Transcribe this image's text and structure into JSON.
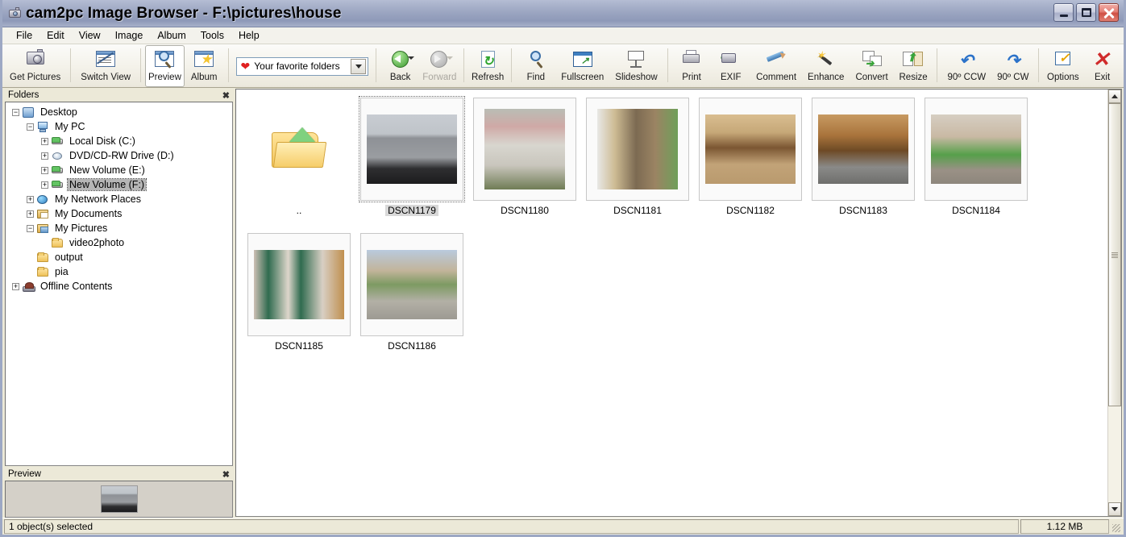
{
  "window": {
    "title": "cam2pc Image Browser - F:\\pictures\\house",
    "icon": "camera-icon",
    "controls": {
      "minimize": "minimize-icon",
      "maximize": "maximize-icon",
      "close": "close-icon"
    }
  },
  "menubar": {
    "items": [
      "File",
      "Edit",
      "View",
      "Image",
      "Album",
      "Tools",
      "Help"
    ]
  },
  "toolbar": {
    "buttons": [
      {
        "label": "Get Pictures",
        "icon": "camera-icon",
        "state": "normal"
      },
      {
        "label": "Switch View",
        "icon": "switch-view-icon",
        "state": "normal"
      },
      {
        "label": "Preview",
        "icon": "preview-magnifier-icon",
        "state": "active"
      },
      {
        "label": "Album",
        "icon": "album-star-icon",
        "state": "normal"
      },
      {
        "label": "Back",
        "icon": "back-arrow-icon",
        "state": "normal"
      },
      {
        "label": "Forward",
        "icon": "forward-arrow-icon",
        "state": "disabled"
      },
      {
        "label": "Refresh",
        "icon": "refresh-icon",
        "state": "normal"
      },
      {
        "label": "Find",
        "icon": "find-magnifier-icon",
        "state": "normal"
      },
      {
        "label": "Fullscreen",
        "icon": "fullscreen-icon",
        "state": "normal"
      },
      {
        "label": "Slideshow",
        "icon": "slideshow-projector-icon",
        "state": "normal"
      },
      {
        "label": "Print",
        "icon": "printer-icon",
        "state": "normal"
      },
      {
        "label": "EXIF",
        "icon": "exif-camera-icon",
        "state": "normal"
      },
      {
        "label": "Comment",
        "icon": "pencil-icon",
        "state": "normal"
      },
      {
        "label": "Enhance",
        "icon": "magic-wand-icon",
        "state": "normal"
      },
      {
        "label": "Convert",
        "icon": "convert-images-icon",
        "state": "normal"
      },
      {
        "label": "Resize",
        "icon": "resize-icon",
        "state": "normal"
      },
      {
        "label": "90º CCW",
        "icon": "rotate-ccw-icon",
        "state": "normal"
      },
      {
        "label": "90º CW",
        "icon": "rotate-cw-icon",
        "state": "normal"
      },
      {
        "label": "Options",
        "icon": "options-checkbox-icon",
        "state": "normal"
      },
      {
        "label": "Exit",
        "icon": "exit-x-icon",
        "state": "normal"
      }
    ],
    "favorites_combo": {
      "value": "Your favorite folders",
      "icon": "heart-icon",
      "dropdown_icon": "chevron-down-icon"
    }
  },
  "folders_panel": {
    "caption": "Folders",
    "close_icon": "close-icon",
    "tree": [
      {
        "label": "Desktop",
        "indent": 0,
        "expander": "minus",
        "icon": "desktop-icon",
        "selected": false
      },
      {
        "label": "My PC",
        "indent": 1,
        "expander": "minus",
        "icon": "my-pc-icon",
        "selected": false
      },
      {
        "label": "Local Disk (C:)",
        "indent": 2,
        "expander": "plus",
        "icon": "hard-drive-icon",
        "selected": false
      },
      {
        "label": "DVD/CD-RW Drive (D:)",
        "indent": 2,
        "expander": "plus",
        "icon": "dvd-drive-icon",
        "selected": false
      },
      {
        "label": "New Volume (E:)",
        "indent": 2,
        "expander": "plus",
        "icon": "hard-drive-icon",
        "selected": false
      },
      {
        "label": "New Volume (F:)",
        "indent": 2,
        "expander": "plus",
        "icon": "hard-drive-icon",
        "selected": true
      },
      {
        "label": "My Network Places",
        "indent": 1,
        "expander": "plus",
        "icon": "network-globe-icon",
        "selected": false
      },
      {
        "label": "My Documents",
        "indent": 1,
        "expander": "plus",
        "icon": "documents-icon",
        "selected": false
      },
      {
        "label": "My Pictures",
        "indent": 1,
        "expander": "minus",
        "icon": "pictures-icon",
        "selected": false
      },
      {
        "label": "video2photo",
        "indent": 2,
        "expander": "none",
        "icon": "folder-icon",
        "selected": false
      },
      {
        "label": "output",
        "indent": 1,
        "expander": "none",
        "icon": "folder-icon",
        "selected": false
      },
      {
        "label": "pia",
        "indent": 1,
        "expander": "none",
        "icon": "folder-icon",
        "selected": false
      },
      {
        "label": "Offline Contents",
        "indent": 0,
        "expander": "plus",
        "icon": "offline-contents-icon",
        "selected": false
      }
    ]
  },
  "preview_panel": {
    "caption": "Preview",
    "close_icon": "close-icon",
    "thumbnail_of": "DSCN1179"
  },
  "thumbnails": {
    "items": [
      {
        "caption": "..",
        "type": "parent-folder",
        "selected": false,
        "orientation": "none"
      },
      {
        "caption": "DSCN1179",
        "type": "image",
        "selected": true,
        "orientation": "landscape"
      },
      {
        "caption": "DSCN1180",
        "type": "image",
        "selected": false,
        "orientation": "portrait"
      },
      {
        "caption": "DSCN1181",
        "type": "image",
        "selected": false,
        "orientation": "portrait"
      },
      {
        "caption": "DSCN1182",
        "type": "image",
        "selected": false,
        "orientation": "landscape"
      },
      {
        "caption": "DSCN1183",
        "type": "image",
        "selected": false,
        "orientation": "landscape"
      },
      {
        "caption": "DSCN1184",
        "type": "image",
        "selected": false,
        "orientation": "landscape"
      },
      {
        "caption": "DSCN1185",
        "type": "image",
        "selected": false,
        "orientation": "landscape"
      },
      {
        "caption": "DSCN1186",
        "type": "image",
        "selected": false,
        "orientation": "landscape"
      }
    ]
  },
  "scrollbar": {
    "up_icon": "chevron-up-icon",
    "down_icon": "chevron-down-icon"
  },
  "statusbar": {
    "left_text": "1 object(s) selected",
    "right_text": "1.12 MB"
  },
  "colors": {
    "titlebar": "#9aa4c0",
    "selection": "#b5b5b5",
    "accent_green": "#3d9a30",
    "accent_red": "#d02b2b",
    "toolbar_bg": "#f4f2ea"
  }
}
